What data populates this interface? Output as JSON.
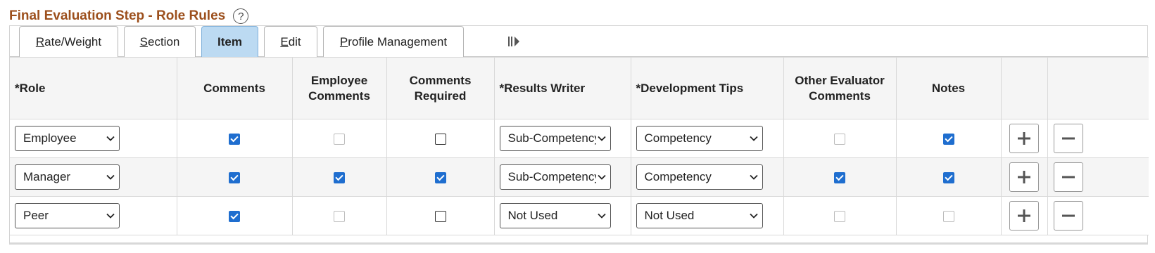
{
  "page": {
    "title": "Final Evaluation Step - Role Rules"
  },
  "tabs": [
    {
      "label": "Rate/Weight",
      "active": false
    },
    {
      "label": "Section",
      "active": false
    },
    {
      "label": "Item",
      "active": true
    },
    {
      "label": "Edit",
      "active": false
    },
    {
      "label": "Profile Management",
      "active": false
    }
  ],
  "columns": {
    "role": "*Role",
    "comments": "Comments",
    "employee_comments": "Employee Comments",
    "comments_required": "Comments Required",
    "results_writer": "*Results Writer",
    "development_tips": "*Development Tips",
    "other_evaluator_comments": "Other Evaluator Comments",
    "notes": "Notes"
  },
  "rows": [
    {
      "role": "Employee",
      "comments": true,
      "employee_comments": false,
      "employee_comments_disabled": true,
      "comments_required": false,
      "results_writer": "Sub-Competency",
      "development_tips": "Competency",
      "other_evaluator_comments": false,
      "other_evaluator_comments_disabled": true,
      "notes": true,
      "notes_disabled": false
    },
    {
      "role": "Manager",
      "comments": true,
      "employee_comments": true,
      "employee_comments_disabled": false,
      "comments_required": true,
      "results_writer": "Sub-Competency",
      "development_tips": "Competency",
      "other_evaluator_comments": true,
      "other_evaluator_comments_disabled": false,
      "notes": true,
      "notes_disabled": false
    },
    {
      "role": "Peer",
      "comments": true,
      "employee_comments": false,
      "employee_comments_disabled": true,
      "comments_required": false,
      "results_writer": "Not Used",
      "development_tips": "Not Used",
      "other_evaluator_comments": false,
      "other_evaluator_comments_disabled": true,
      "notes": false,
      "notes_disabled": true
    }
  ],
  "icons": {
    "help": "help-circle-icon",
    "more_tabs": "show-all-columns-icon",
    "add_row": "plus-icon",
    "delete_row": "minus-icon",
    "dropdown": "chevron-down-icon"
  },
  "colors": {
    "title": "#9c4f1c",
    "active_tab": "#bcdaf2",
    "checkbox_checked": "#1f6ecf",
    "header_bg": "#f5f5f5"
  }
}
